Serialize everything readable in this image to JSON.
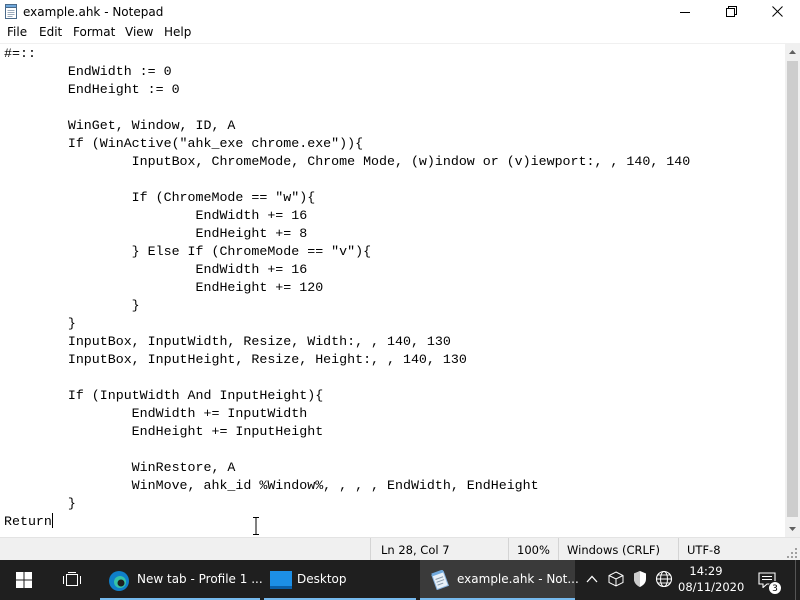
{
  "window": {
    "title": "example.ahk - Notepad"
  },
  "menu": [
    "File",
    "Edit",
    "Format",
    "View",
    "Help"
  ],
  "editor": {
    "lines": [
      "#=::",
      "        EndWidth := 0",
      "        EndHeight := 0",
      "",
      "        WinGet, Window, ID, A",
      "        If (WinActive(\"ahk_exe chrome.exe\")){",
      "                InputBox, ChromeMode, Chrome Mode, (w)indow or (v)iewport:, , 140, 140",
      "",
      "                If (ChromeMode == \"w\"){",
      "                        EndWidth += 16",
      "                        EndHeight += 8",
      "                } Else If (ChromeMode == \"v\"){",
      "                        EndWidth += 16",
      "                        EndHeight += 120",
      "                }",
      "        }",
      "        InputBox, InputWidth, Resize, Width:, , 140, 130",
      "        InputBox, InputHeight, Resize, Height:, , 140, 130",
      "",
      "        If (InputWidth And InputHeight){",
      "                EndWidth += InputWidth",
      "                EndHeight += InputHeight",
      "",
      "                WinRestore, A",
      "                WinMove, ahk_id %Window%, , , , EndWidth, EndHeight",
      "        }",
      "Return"
    ]
  },
  "status": {
    "position": "Ln 28, Col 7",
    "zoom": "100%",
    "line_ending": "Windows (CRLF)",
    "encoding": "UTF-8"
  },
  "taskbar": {
    "chrome_label": "New tab - Profile 1 ...",
    "desktop_label": "Desktop",
    "notepad_label": "example.ahk - Not...",
    "time": "14:29",
    "date": "08/11/2020",
    "notification_count": "3"
  },
  "colors": {
    "taskbar_bg": "#1f1f1f",
    "accent": "#76b9ed",
    "statusbar_bg": "#f0f0f0"
  }
}
